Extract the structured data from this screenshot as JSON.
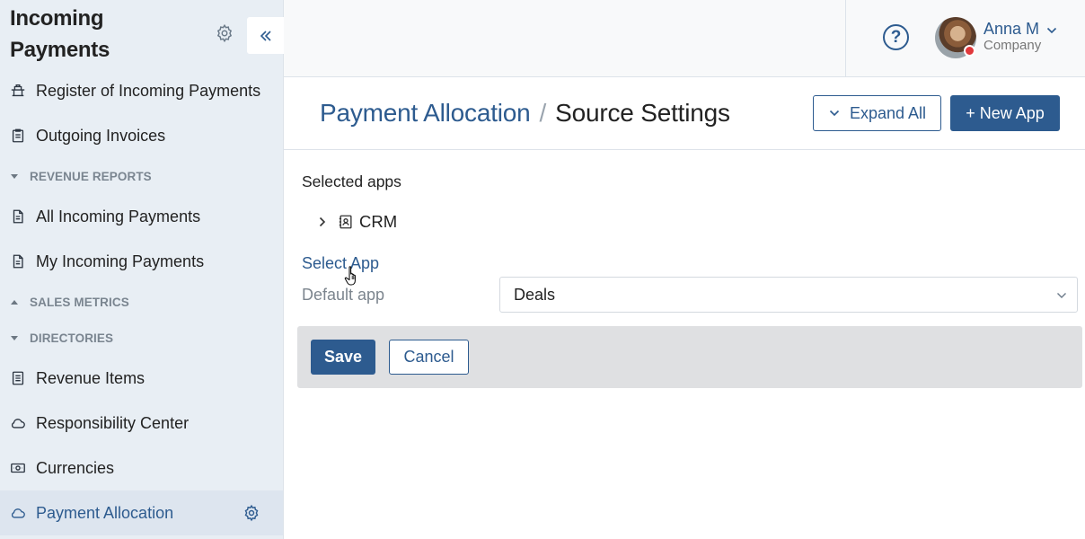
{
  "sidebar": {
    "title_line1": "Incoming",
    "title_line2": "Payments",
    "items": [
      {
        "label": "Register of Incoming Payments",
        "icon": "payments-register-icon"
      },
      {
        "label": "Outgoing Invoices",
        "icon": "clipboard-icon"
      },
      {
        "section": "REVENUE REPORTS",
        "state": "expanded"
      },
      {
        "label": "All Incoming Payments",
        "icon": "document-icon"
      },
      {
        "label": "My Incoming Payments",
        "icon": "document-icon"
      },
      {
        "section": "SALES METRICS",
        "state": "collapsed"
      },
      {
        "section": "DIRECTORIES",
        "state": "expanded"
      },
      {
        "label": "Revenue Items",
        "icon": "list-document-icon"
      },
      {
        "label": "Responsibility Center",
        "icon": "cloud-icon"
      },
      {
        "label": "Currencies",
        "icon": "banknote-icon"
      },
      {
        "label": "Payment Allocation",
        "icon": "cloud-icon",
        "active": true
      }
    ]
  },
  "topbar": {
    "user_name": "Anna M",
    "user_company": "Company",
    "status_color": "#e0383b"
  },
  "header": {
    "breadcrumb_parent": "Payment Allocation",
    "breadcrumb_separator": "/",
    "breadcrumb_current": "Source Settings",
    "expand_all_label": "Expand All",
    "new_app_label": "+ New App"
  },
  "form": {
    "selected_apps_label": "Selected apps",
    "apps": [
      {
        "name": "CRM",
        "icon": "contacts-book-icon"
      }
    ],
    "select_app_link": "Select App",
    "default_app_label": "Default app",
    "default_app_value": "Deals"
  },
  "actions": {
    "save_label": "Save",
    "cancel_label": "Cancel"
  },
  "colors": {
    "accent": "#2d5b8f",
    "sidebar_bg": "#e8eef4",
    "panel_bg": "#dfe0e2"
  }
}
